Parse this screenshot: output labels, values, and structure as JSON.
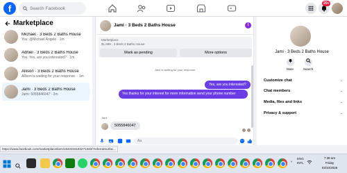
{
  "topbar": {
    "logo": "f",
    "search_placeholder": "Search Facebook",
    "notification_badge": "20+"
  },
  "sidebar": {
    "title": "Marketplace",
    "conversations": [
      {
        "title": "Michael · 3 Beds 2 Baths House",
        "preview": "You: @Michael Angelo · 1m"
      },
      {
        "title": "Adhiel · 3 Beds 2 Baths House",
        "preview": "You: Yes, are you interested? · 1m"
      },
      {
        "title": "Allison · 3 Beds 2 Baths House",
        "preview": "Allison is waiting for your response. · 1m"
      },
      {
        "title": "Jami · 3 Beds 2 Baths House",
        "preview": "Jami: 5055846047 · 2m"
      }
    ]
  },
  "chat": {
    "header_name": "Jami · 3 Beds 2 Baths House",
    "info_icon": "i",
    "listing_source": "Marketplace",
    "listing_detail": "$1,599 · 3 Beds 2 Baths House",
    "mark_pending_label": "Mark as pending",
    "more_options_label": "More options",
    "status_text": "Jami is waiting for your response.",
    "msg_out_1": "Yes, are you interested?",
    "msg_out_2": "Yes thanks for your interest for more information send your phone number",
    "sender_label": "Jami",
    "msg_in": "5055846047",
    "composer_placeholder": "Aa"
  },
  "right_panel": {
    "name": "Jami · 3 Beds 2 Baths House",
    "mute_label": "Mute",
    "search_label": "Search",
    "sections": [
      "Customize chat",
      "Chat members",
      "Media, files and links",
      "Privacy & support"
    ]
  },
  "status_url": "https://www.facebook.com/marketplace/item/1940315183271340/?referralSurfac...",
  "taskbar": {
    "lang_top": "ENG",
    "lang_bottom": "INTL",
    "time": "7:38 am",
    "day": "Friday",
    "date": "03/10/2025"
  },
  "colors": {
    "accent": "#0866ff",
    "outgoing_bubble": "#6a3ce6",
    "badge": "#e41e3f"
  }
}
